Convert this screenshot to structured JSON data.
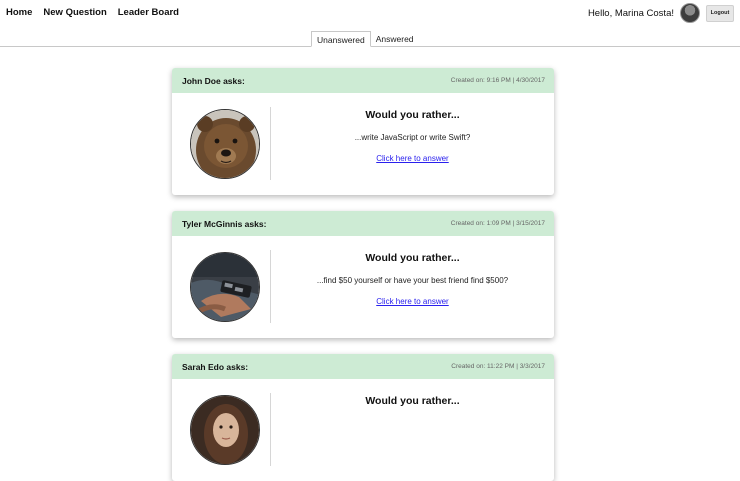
{
  "nav": {
    "links": [
      "Home",
      "New Question",
      "Leader Board"
    ],
    "greeting": "Hello, Marina Costa!",
    "logout_label": "Logout"
  },
  "tabs": [
    {
      "label": "Unanswered",
      "active": true
    },
    {
      "label": "Answered",
      "active": false
    }
  ],
  "colors": {
    "card_header": "#cdebd4",
    "link": "#2a20ee"
  },
  "questions": [
    {
      "author_label": "John Doe asks:",
      "created": "Created on: 9:16 PM | 4/30/2017",
      "title": "Would you rather...",
      "preview": "...write JavaScript or write Swift?",
      "link_label": "Click here to answer",
      "avatar_icon": "bear-photo"
    },
    {
      "author_label": "Tyler McGinnis asks:",
      "created": "Created on: 1:09 PM | 3/15/2017",
      "title": "Would you rather...",
      "preview": "...find $50 yourself or have your best friend find $500?",
      "link_label": "Click here to answer",
      "avatar_icon": "hands-photo"
    },
    {
      "author_label": "Sarah Edo asks:",
      "created": "Created on: 11:22 PM | 3/3/2017",
      "title": "Would you rather...",
      "preview": "",
      "link_label": "",
      "avatar_icon": "woman-photo"
    }
  ]
}
